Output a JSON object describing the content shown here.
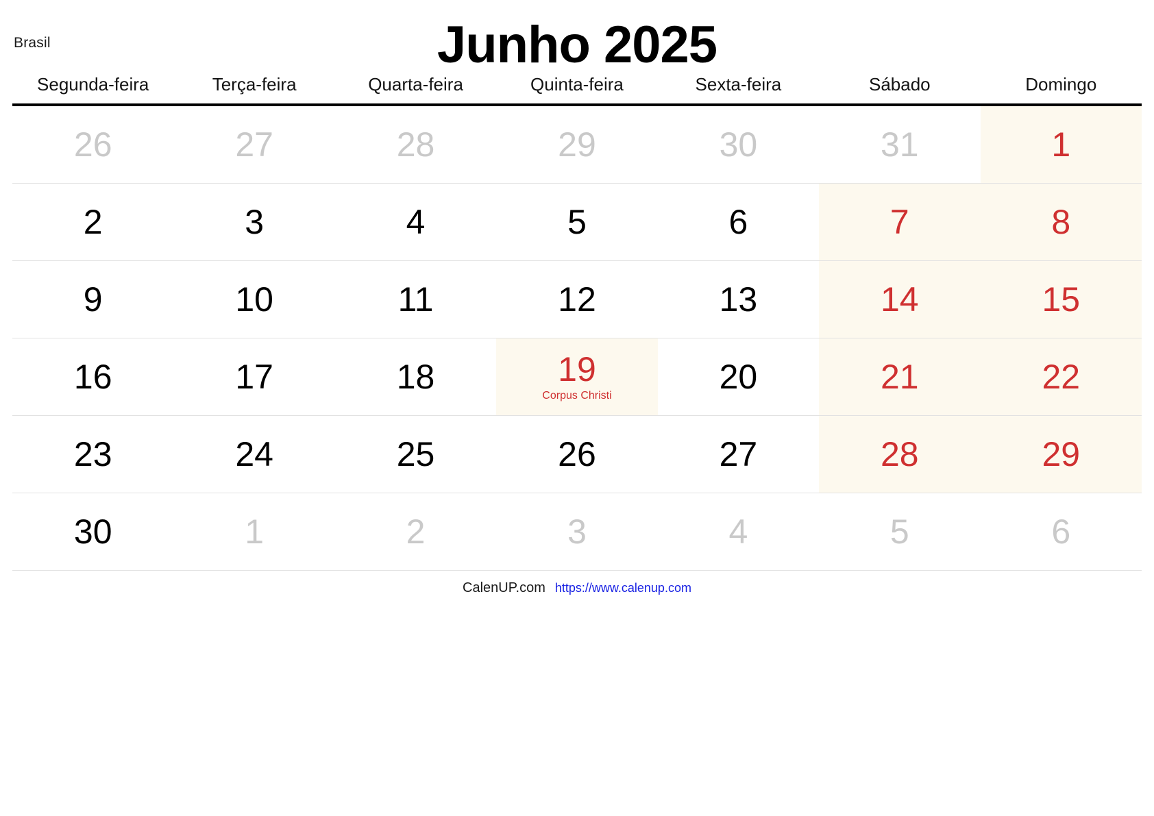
{
  "header": {
    "country": "Brasil",
    "title": "Junho 2025"
  },
  "weekdays": [
    "Segunda-feira",
    "Terça-feira",
    "Quarta-feira",
    "Quinta-feira",
    "Sexta-feira",
    "Sábado",
    "Domingo"
  ],
  "colors": {
    "weekend_text": "#cf3030",
    "out_of_month_text": "#c9c9c9",
    "in_month_text": "#000000",
    "weekend_background": "#fdf9ee",
    "holiday_background": "#fdf9ee",
    "holiday_text": "#cf3030",
    "header_rule": "#000000",
    "row_divider": "#e2e2e2",
    "url_link": "#1821e3"
  },
  "weeks": [
    {
      "days": [
        {
          "num": "26",
          "in_month": false,
          "weekend": false,
          "holiday": null
        },
        {
          "num": "27",
          "in_month": false,
          "weekend": false,
          "holiday": null
        },
        {
          "num": "28",
          "in_month": false,
          "weekend": false,
          "holiday": null
        },
        {
          "num": "29",
          "in_month": false,
          "weekend": false,
          "holiday": null
        },
        {
          "num": "30",
          "in_month": false,
          "weekend": false,
          "holiday": null
        },
        {
          "num": "31",
          "in_month": false,
          "weekend": true,
          "holiday": null
        },
        {
          "num": "1",
          "in_month": true,
          "weekend": true,
          "holiday": null
        }
      ]
    },
    {
      "days": [
        {
          "num": "2",
          "in_month": true,
          "weekend": false,
          "holiday": null
        },
        {
          "num": "3",
          "in_month": true,
          "weekend": false,
          "holiday": null
        },
        {
          "num": "4",
          "in_month": true,
          "weekend": false,
          "holiday": null
        },
        {
          "num": "5",
          "in_month": true,
          "weekend": false,
          "holiday": null
        },
        {
          "num": "6",
          "in_month": true,
          "weekend": false,
          "holiday": null
        },
        {
          "num": "7",
          "in_month": true,
          "weekend": true,
          "holiday": null
        },
        {
          "num": "8",
          "in_month": true,
          "weekend": true,
          "holiday": null
        }
      ]
    },
    {
      "days": [
        {
          "num": "9",
          "in_month": true,
          "weekend": false,
          "holiday": null
        },
        {
          "num": "10",
          "in_month": true,
          "weekend": false,
          "holiday": null
        },
        {
          "num": "11",
          "in_month": true,
          "weekend": false,
          "holiday": null
        },
        {
          "num": "12",
          "in_month": true,
          "weekend": false,
          "holiday": null
        },
        {
          "num": "13",
          "in_month": true,
          "weekend": false,
          "holiday": null
        },
        {
          "num": "14",
          "in_month": true,
          "weekend": true,
          "holiday": null
        },
        {
          "num": "15",
          "in_month": true,
          "weekend": true,
          "holiday": null
        }
      ]
    },
    {
      "days": [
        {
          "num": "16",
          "in_month": true,
          "weekend": false,
          "holiday": null
        },
        {
          "num": "17",
          "in_month": true,
          "weekend": false,
          "holiday": null
        },
        {
          "num": "18",
          "in_month": true,
          "weekend": false,
          "holiday": null
        },
        {
          "num": "19",
          "in_month": true,
          "weekend": false,
          "holiday": "Corpus Christi"
        },
        {
          "num": "20",
          "in_month": true,
          "weekend": false,
          "holiday": null
        },
        {
          "num": "21",
          "in_month": true,
          "weekend": true,
          "holiday": null
        },
        {
          "num": "22",
          "in_month": true,
          "weekend": true,
          "holiday": null
        }
      ]
    },
    {
      "days": [
        {
          "num": "23",
          "in_month": true,
          "weekend": false,
          "holiday": null
        },
        {
          "num": "24",
          "in_month": true,
          "weekend": false,
          "holiday": null
        },
        {
          "num": "25",
          "in_month": true,
          "weekend": false,
          "holiday": null
        },
        {
          "num": "26",
          "in_month": true,
          "weekend": false,
          "holiday": null
        },
        {
          "num": "27",
          "in_month": true,
          "weekend": false,
          "holiday": null
        },
        {
          "num": "28",
          "in_month": true,
          "weekend": true,
          "holiday": null
        },
        {
          "num": "29",
          "in_month": true,
          "weekend": true,
          "holiday": null
        }
      ]
    },
    {
      "days": [
        {
          "num": "30",
          "in_month": true,
          "weekend": false,
          "holiday": null
        },
        {
          "num": "1",
          "in_month": false,
          "weekend": false,
          "holiday": null
        },
        {
          "num": "2",
          "in_month": false,
          "weekend": false,
          "holiday": null
        },
        {
          "num": "3",
          "in_month": false,
          "weekend": false,
          "holiday": null
        },
        {
          "num": "4",
          "in_month": false,
          "weekend": false,
          "holiday": null
        },
        {
          "num": "5",
          "in_month": false,
          "weekend": true,
          "holiday": null
        },
        {
          "num": "6",
          "in_month": false,
          "weekend": true,
          "holiday": null
        }
      ]
    }
  ],
  "footer": {
    "brand": "CalenUP.com",
    "url": "https://www.calenup.com"
  }
}
